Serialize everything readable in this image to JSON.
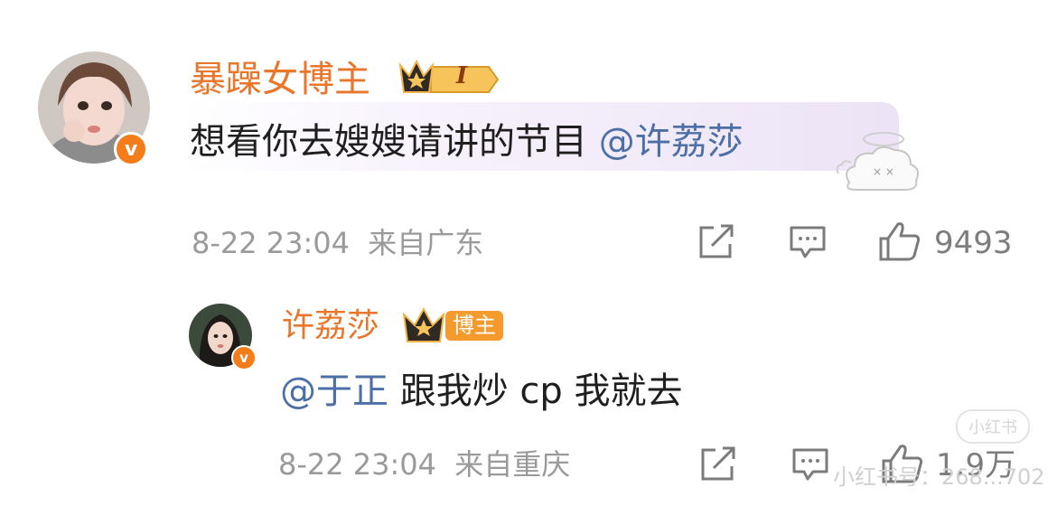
{
  "comment": {
    "username": "暴躁女博主",
    "level_badge": "I",
    "text_before": "想看你去嫂嫂请讲的节目 ",
    "mention": "@许荔莎",
    "time": "8-22 23:04",
    "location": "来自广东",
    "likes": "9493",
    "avatar_badge": "v"
  },
  "reply": {
    "username": "许荔莎",
    "role_badge": "博主",
    "mention": "@于正",
    "text_after": " 跟我炒 cp 我就去",
    "time": "8-22 23:04",
    "location": "来自重庆",
    "likes": "1.9万",
    "avatar_badge": "v"
  },
  "watermark": {
    "brand": "小红书",
    "handle": "小红书号：268...702"
  },
  "icons": {
    "share": "share-icon",
    "comment": "comment-icon",
    "like": "thumbs-up-icon",
    "crown": "crown-icon",
    "sticker": "sleepy-cloud-sticker"
  },
  "colors": {
    "username": "#e8762b",
    "mention": "#4d6fa7",
    "meta": "#9a9a9a",
    "verified": "#f47d1b"
  }
}
